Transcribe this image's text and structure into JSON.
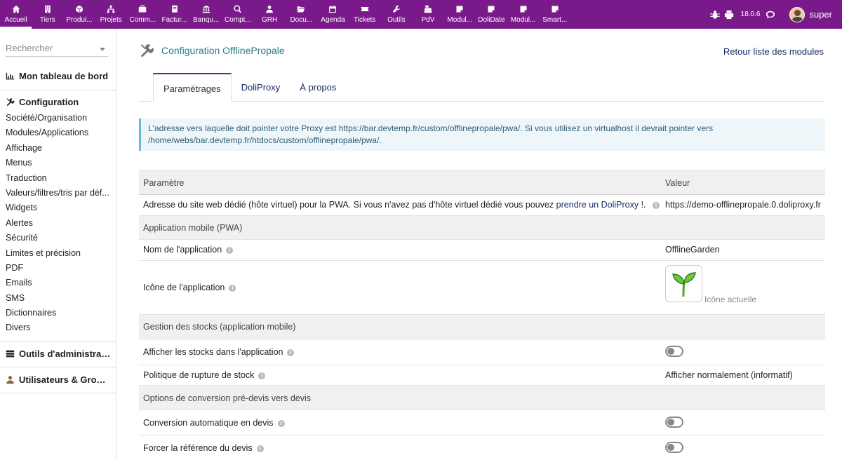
{
  "topmenu": [
    {
      "label": "Accueil",
      "icon": "home-icon"
    },
    {
      "label": "Tiers",
      "icon": "building-icon"
    },
    {
      "label": "Produi...",
      "icon": "cube-icon"
    },
    {
      "label": "Projets",
      "icon": "sitemap-icon"
    },
    {
      "label": "Comm...",
      "icon": "briefcase-icon"
    },
    {
      "label": "Factur...",
      "icon": "invoice-icon"
    },
    {
      "label": "Banqu...",
      "icon": "bank-icon"
    },
    {
      "label": "Compt...",
      "icon": "search-dollar-icon"
    },
    {
      "label": "GRH",
      "icon": "user-tie-icon"
    },
    {
      "label": "Docu...",
      "icon": "folder-open-icon"
    },
    {
      "label": "Agenda",
      "icon": "calendar-icon"
    },
    {
      "label": "Tickets",
      "icon": "ticket-icon"
    },
    {
      "label": "Outils",
      "icon": "wrench-icon"
    },
    {
      "label": "PdV",
      "icon": "cash-register-icon"
    },
    {
      "label": "Modul...",
      "icon": "module-icon"
    },
    {
      "label": "DoliDate",
      "icon": "module-icon"
    },
    {
      "label": "Modul...",
      "icon": "module-icon"
    },
    {
      "label": "Smart...",
      "icon": "module-icon"
    }
  ],
  "topright": {
    "version": "18.0.6",
    "username": "super"
  },
  "sidebar": {
    "search_placeholder": "Rechercher",
    "dashboard": "Mon tableau de bord",
    "config": "Configuration",
    "items": [
      "Société/Organisation",
      "Modules/Applications",
      "Affichage",
      "Menus",
      "Traduction",
      "Valeurs/filtres/tris par déf...",
      "Widgets",
      "Alertes",
      "Sécurité",
      "Limites et précision",
      "PDF",
      "Emails",
      "SMS",
      "Dictionnaires",
      "Divers"
    ],
    "admin_tools": "Outils d'administrati...",
    "users_groups": "Utilisateurs & Group..."
  },
  "page": {
    "title": "Configuration OfflinePropale",
    "back_link": "Retour liste des modules"
  },
  "tabs": [
    "Paramétrages",
    "DoliProxy",
    "À propos"
  ],
  "info": "L'adresse vers laquelle doit pointer votre Proxy est https://bar.devtemp.fr/custom/offlinepropale/pwa/. Si vous utilisez un virtualhost il devrait pointer vers /home/webs/bar.devtemp.fr/htdocs/custom/offlinepropale/pwa/.",
  "table": {
    "header": {
      "param": "Paramètre",
      "value": "Valeur"
    },
    "site_label": "Adresse du site web dédié (hôte virtuel) pour la PWA. Si vous n'avez pas d'hôte virtuel dédié vous pouvez",
    "site_link": "prendre un DoliProxy !",
    "site_value": "https://demo-offlinepropale.0.doliproxy.fr",
    "sec_pwa": "Application mobile (PWA)",
    "app_name_label": "Nom de l'application",
    "app_name_value": "OfflineGarden",
    "app_icon_label": "Icône de l'application",
    "app_icon_caption": "Icône actuelle",
    "sec_stock": "Gestion des stocks (application mobile)",
    "show_stock_label": "Afficher les stocks dans l'application",
    "rupture_label": "Politique de rupture de stock",
    "rupture_value": "Afficher normalement (informatif)",
    "sec_conv": "Options de conversion pré-devis vers devis",
    "auto_conv_label": "Conversion automatique en devis",
    "force_ref_label": "Forcer la référence du devis"
  },
  "colors": {
    "topbar": "#7a1a8a",
    "link": "#1a2a66",
    "title": "#2b7a8c",
    "info_bg": "#eef6fa"
  }
}
